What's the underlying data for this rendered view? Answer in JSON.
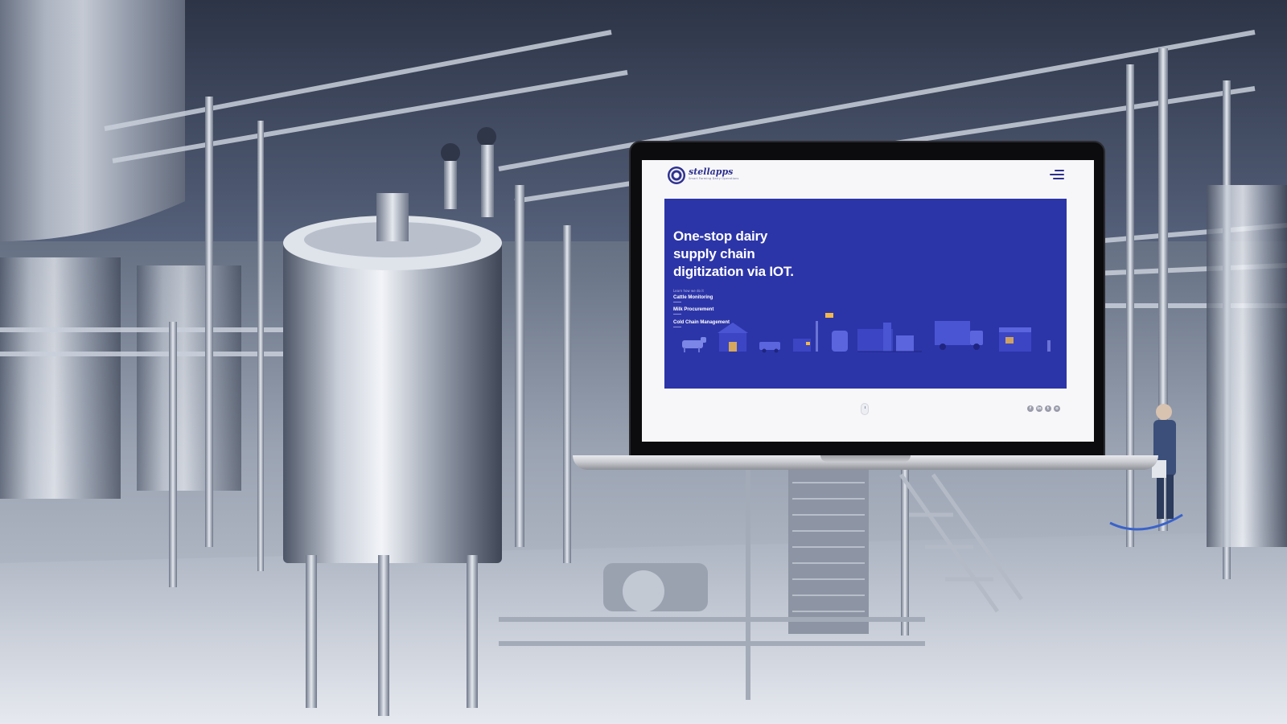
{
  "site": {
    "logo_text": "stellapps",
    "logo_tagline": "Smart Farming Dairy Operations",
    "hero": {
      "title_lines": [
        "One-stop dairy",
        "supply chain",
        "digitization via IOT."
      ],
      "learn_label": "Learn how we do it",
      "links": [
        "Cattle Monitoring",
        "Milk Procurement",
        "Cold Chain Management"
      ]
    },
    "social_icons": [
      {
        "name": "facebook-icon",
        "glyph": "f"
      },
      {
        "name": "linkedin-icon",
        "glyph": "in"
      },
      {
        "name": "twitter-icon",
        "glyph": "t"
      },
      {
        "name": "instagram-icon",
        "glyph": "o"
      }
    ]
  },
  "colors": {
    "brand_blue": "#2c35a8",
    "logo_navy": "#2d2f8f",
    "screen_bg": "#f7f7f9",
    "background_tint": "#6c778a"
  }
}
